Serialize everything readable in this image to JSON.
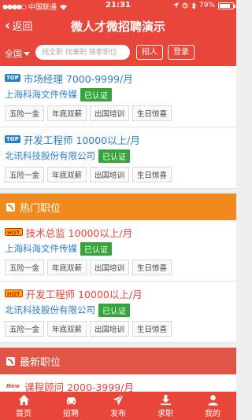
{
  "status": {
    "carrier": "中国联通",
    "time": "21:31",
    "battery": "79%",
    "battery_level": 0.79
  },
  "nav": {
    "back_label": "返回",
    "title": "微人才微招聘演示"
  },
  "search": {
    "region": "全国",
    "placeholder": "找全职 找兼职 搜索职位",
    "recruit_button": "招人",
    "login_button": "登录"
  },
  "top_jobs": [
    {
      "badge": "TOP",
      "title": "市场经理",
      "salary": "7000-9999/月",
      "company": "上海科海文件传媒",
      "verified": "已认证",
      "tags": [
        "五险一金",
        "年底双薪",
        "出国培训",
        "生日惊喜"
      ]
    },
    {
      "badge": "TOP",
      "title": "开发工程师",
      "salary": "10000以上/月",
      "company": "北讯科技股份有限公司",
      "verified": "已认证",
      "tags": [
        "五险一金",
        "年底双薪",
        "出国培训",
        "生日惊喜"
      ]
    }
  ],
  "hot_section": {
    "title": "热门职位"
  },
  "hot_jobs": [
    {
      "badge": "HOT",
      "title": "技术总监",
      "salary": "10000以上/月",
      "company": "上海科海文件传媒",
      "verified": "已认证",
      "tags": [
        "五险一金",
        "年底双薪",
        "出国培训",
        "生日惊喜"
      ]
    },
    {
      "badge": "HOT",
      "title": "开发工程师",
      "salary": "10000以上/月",
      "company": "北讯科技股份有限公司",
      "verified": "已认证",
      "tags": [
        "五险一金",
        "年底双薪",
        "出国培训",
        "生日惊喜"
      ]
    }
  ],
  "new_section": {
    "title": "最新职位"
  },
  "new_jobs": [
    {
      "badge": "New",
      "title": "课程顾问",
      "salary": "2000-3999/月"
    }
  ],
  "tabs": [
    {
      "label": "首页",
      "icon": "home-icon"
    },
    {
      "label": "招聘",
      "icon": "car-icon"
    },
    {
      "label": "发布",
      "icon": "send-icon"
    },
    {
      "label": "求职",
      "icon": "download-icon"
    },
    {
      "label": "我的",
      "icon": "user-icon"
    }
  ],
  "colors": {
    "primary": "#e8463a",
    "hot_header": "#f08a1e",
    "link_blue": "#2a7fc9",
    "verified_green": "#35a53b"
  }
}
